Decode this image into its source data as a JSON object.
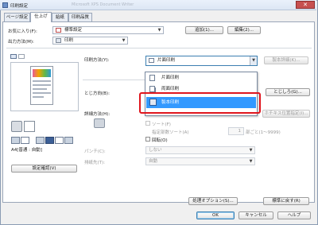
{
  "window": {
    "title": "印刷設定",
    "blurred_title": "Microsoft XPS Document Writer",
    "close_glyph": "✕"
  },
  "tabs": [
    "ページ設定",
    "仕上げ",
    "給紙",
    "印刷品質"
  ],
  "active_tab": "仕上げ",
  "favorites": {
    "label": "お気に入り(F):",
    "value": "標準設定",
    "add": "追加(1)...",
    "edit": "編集(2)..."
  },
  "output": {
    "label": "出力方法(M):",
    "value": "印刷"
  },
  "print_method": {
    "label": "印刷方法(Y):",
    "value": "片面印刷",
    "binding_button": "製本詳細(K)..."
  },
  "dropdown": {
    "items": [
      "片面印刷",
      "両面印刷",
      "製本印刷"
    ],
    "selected_index": 2
  },
  "orientation": {
    "label": "とじ方向(B):",
    "button": "とじしろ(G)..."
  },
  "detail": {
    "label": "詳細方法(H):",
    "button": "ホチキス位置指定(I)..."
  },
  "sort": {
    "label": "ソート(F)",
    "copies_label": "指定部数ソート(A)",
    "spinner_value": "1",
    "range": "部ごと(1〜9999)"
  },
  "rotate": {
    "label": "回転(O)"
  },
  "punch": {
    "label": "パンチ(C):",
    "value": "しない"
  },
  "staple": {
    "label": "排紙先(T):",
    "value": "自動"
  },
  "preview": {
    "paper_info": "A4[普通 : 自動]",
    "confirm": "設定確認(V)"
  },
  "footer": {
    "options": "処理オプション(S)...",
    "defaults": "標準に戻す(R)",
    "ok": "OK",
    "cancel": "キャンセル",
    "help": "ヘルプ"
  },
  "colors": {
    "selection": "#3399ff",
    "highlight": "#e0161e"
  }
}
